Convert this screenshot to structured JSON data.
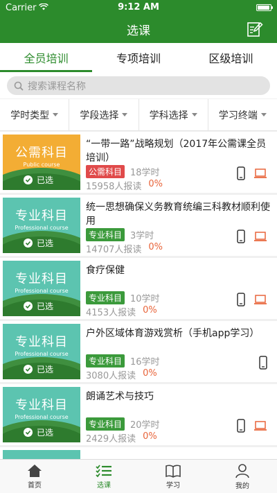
{
  "status": {
    "carrier": "Carrier",
    "time": "9:12 AM"
  },
  "nav": {
    "title": "选课"
  },
  "tabs": [
    {
      "label": "全员培训"
    },
    {
      "label": "专项培训"
    },
    {
      "label": "区级培训"
    }
  ],
  "search": {
    "placeholder": "搜索课程名称"
  },
  "filters": [
    {
      "label": "学时类型"
    },
    {
      "label": "学段选择"
    },
    {
      "label": "学科选择"
    },
    {
      "label": "学习终端"
    }
  ],
  "courses": [
    {
      "thumb_title": "公需科目",
      "thumb_sub": "Public course",
      "thumb_color": "#f3ad34",
      "selected_label": "已选",
      "title": "“一带一路”战略规划（2017年公需课全员培训）",
      "badge": "公需科目",
      "badge_type": "red",
      "hours": "18学时",
      "readers": "15958人报读",
      "percent": "0%"
    },
    {
      "thumb_title": "专业科目",
      "thumb_sub": "Professional course",
      "thumb_color": "#5cc4b0",
      "selected_label": "已选",
      "title": "统一思想确保义务教育统编三科教材顺利使用",
      "badge": "专业科目",
      "badge_type": "green",
      "hours": "3学时",
      "readers": "14707人报读",
      "percent": "0%"
    },
    {
      "thumb_title": "专业科目",
      "thumb_sub": "Professional course",
      "thumb_color": "#5cc4b0",
      "selected_label": "已选",
      "title": "食疗保健",
      "badge": "专业科目",
      "badge_type": "green",
      "hours": "10学时",
      "readers": "4153人报读",
      "percent": "0%"
    },
    {
      "thumb_title": "专业科目",
      "thumb_sub": "Professional course",
      "thumb_color": "#5cc4b0",
      "selected_label": "已选",
      "title": "户外区域体育游戏赏析（手机app学习）",
      "badge": "专业科目",
      "badge_type": "green",
      "hours": "16学时",
      "readers": "3080人报读",
      "percent": "0%"
    },
    {
      "thumb_title": "专业科目",
      "thumb_sub": "Professional course",
      "thumb_color": "#5cc4b0",
      "selected_label": "已选",
      "title": "朗诵艺术与技巧",
      "badge": "专业科目",
      "badge_type": "green",
      "hours": "20学时",
      "readers": "2429人报读",
      "percent": "0%"
    }
  ],
  "tabbar": [
    {
      "label": "首页",
      "icon": "home-icon"
    },
    {
      "label": "选课",
      "icon": "list-icon"
    },
    {
      "label": "学习",
      "icon": "book-icon"
    },
    {
      "label": "我的",
      "icon": "person-icon"
    }
  ],
  "colors": {
    "brand": "#2c8b2c",
    "badge_red": "#e04a4a",
    "badge_green": "#3b9a3b",
    "percent": "#e8643a"
  }
}
